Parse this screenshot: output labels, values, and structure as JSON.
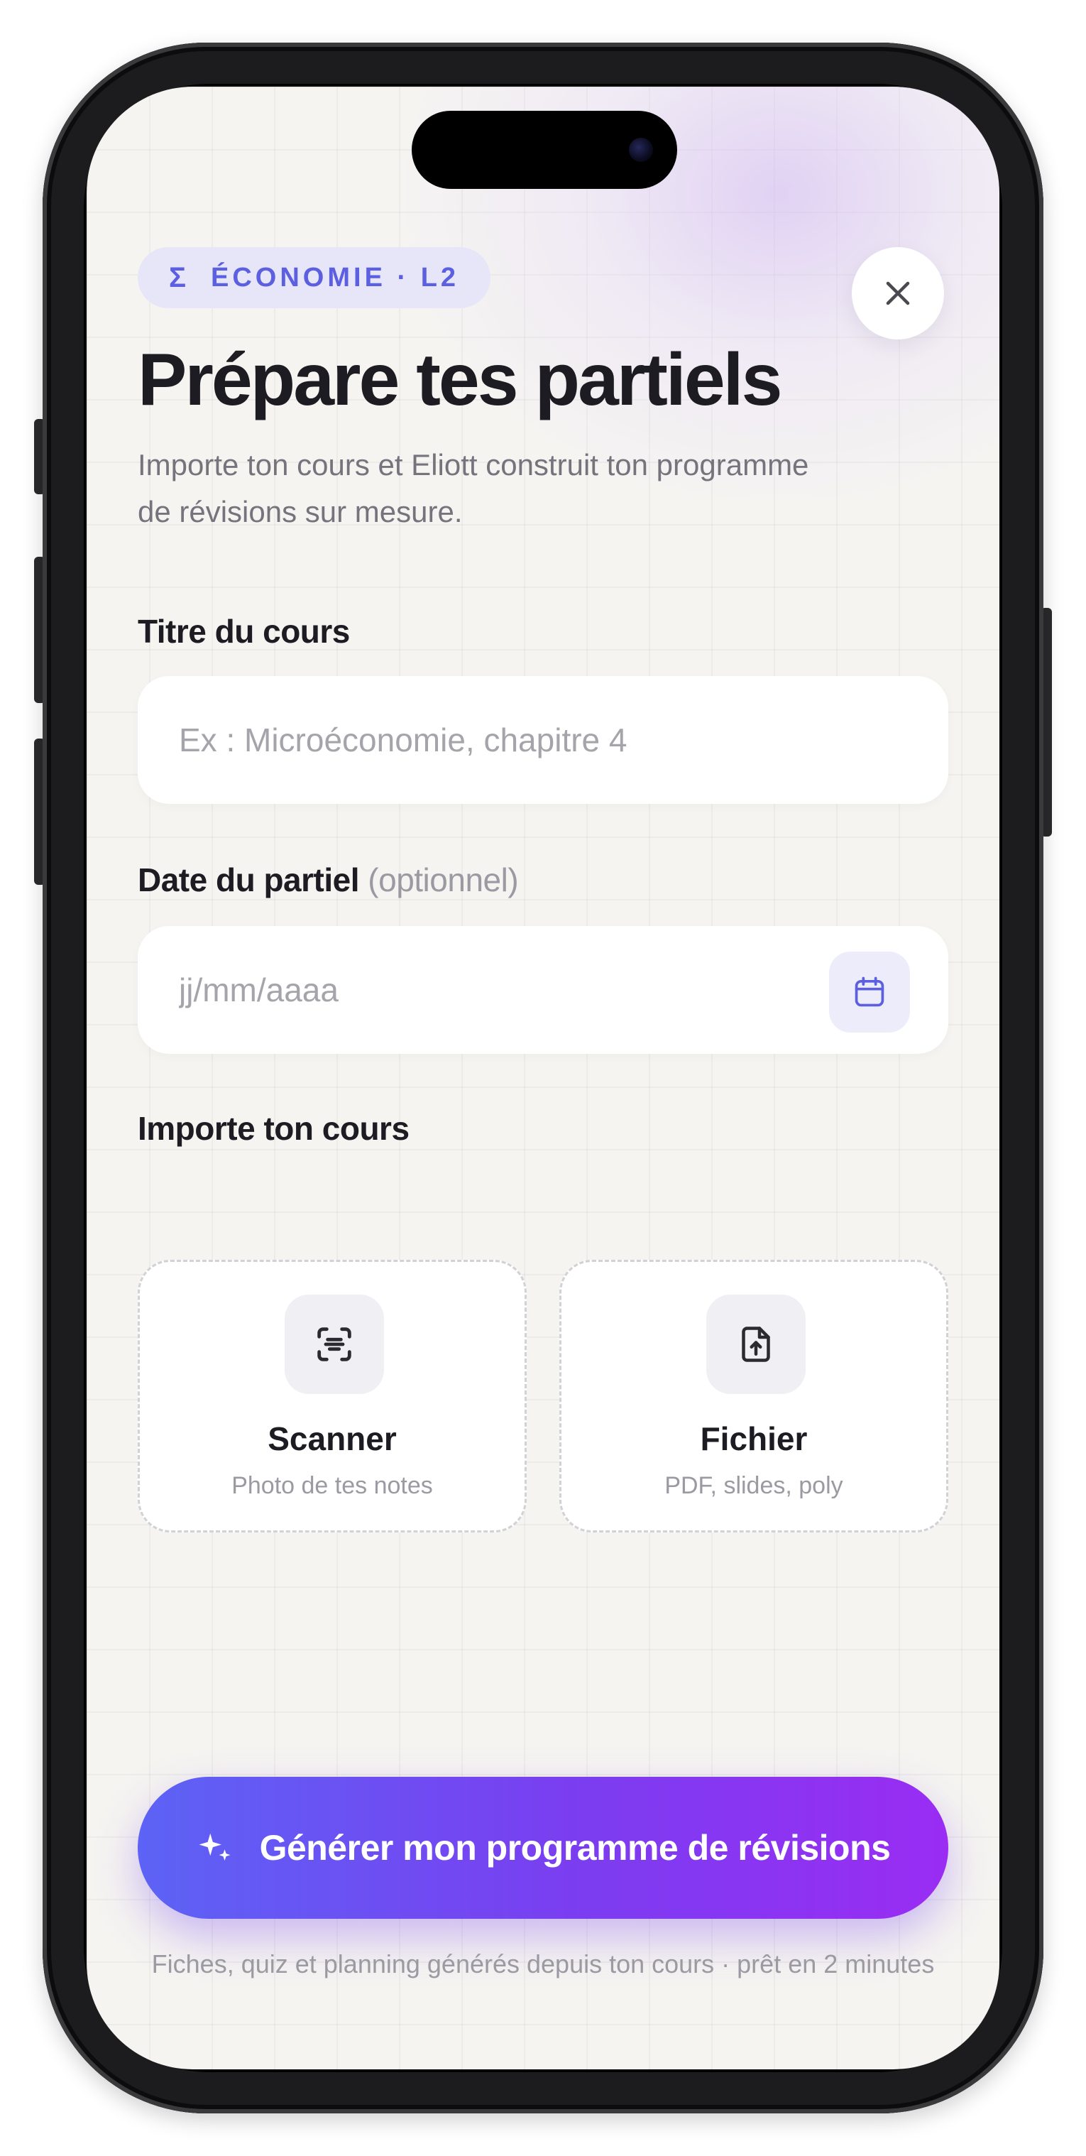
{
  "subject_badge": {
    "symbol": "Σ",
    "label": "ÉCONOMIE · L2"
  },
  "header": {
    "title": "Prépare tes partiels",
    "subtitle": "Importe ton cours et Eliott construit ton programme de révisions sur mesure."
  },
  "course_title": {
    "label": "Titre du cours",
    "placeholder": "Ex : Microéconomie, chapitre 4",
    "value": ""
  },
  "exam_date": {
    "label": "Date du partiel",
    "optional": "(optionnel)",
    "placeholder": "jj/mm/aaaa",
    "value": "",
    "icon": "calendar-icon"
  },
  "import": {
    "label": "Importe ton cours",
    "options": [
      {
        "title": "Scanner",
        "subtitle": "Photo de tes notes",
        "icon": "scan-document-icon"
      },
      {
        "title": "Fichier",
        "subtitle": "PDF, slides, poly",
        "icon": "file-upload-icon"
      }
    ]
  },
  "generate_button": {
    "label": "Générer mon programme de révisions",
    "icon": "sparkles-icon"
  },
  "footnote": "Fiches, quiz et planning générés depuis ton cours · prêt en 2 minutes",
  "colors": {
    "accent": "#5b5fe0",
    "gradient_start": "#5c63f5",
    "gradient_end": "#9a2cf3",
    "background": "#f5f4f1",
    "text_primary": "#1d1c22",
    "text_muted": "#9b9aa2"
  }
}
